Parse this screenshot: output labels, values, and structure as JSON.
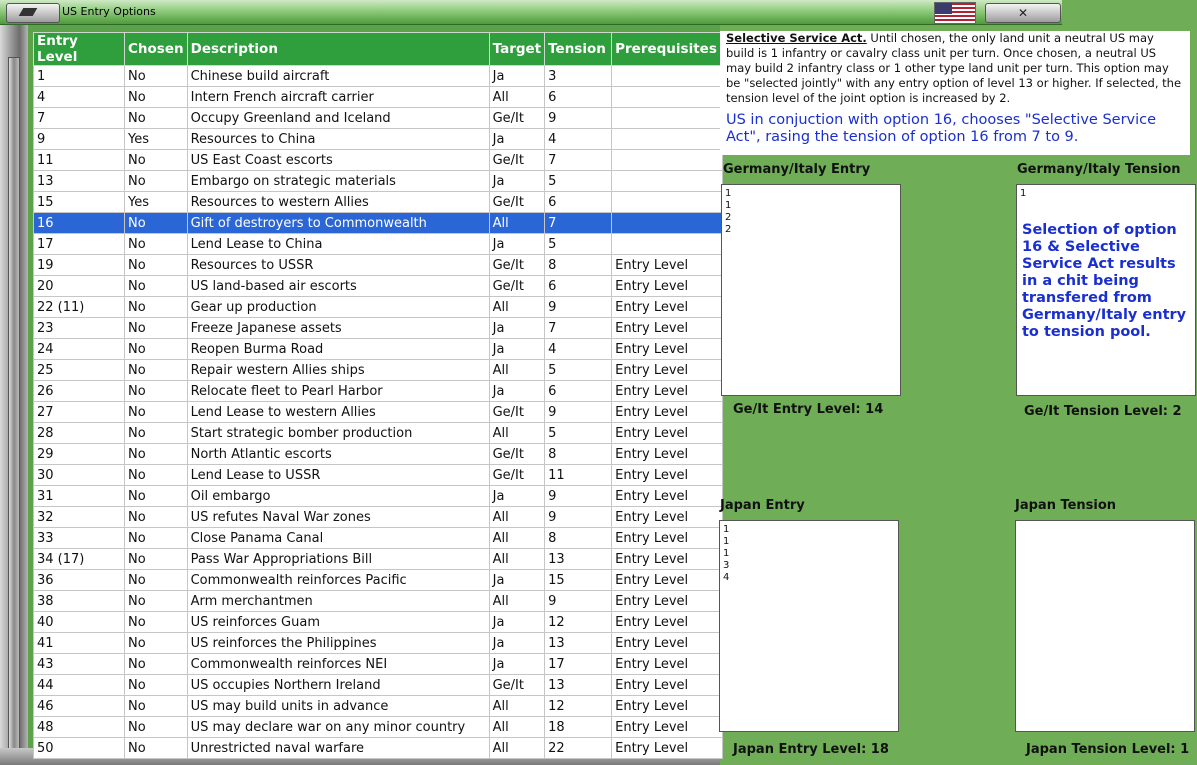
{
  "window": {
    "title": "US Entry Options"
  },
  "table": {
    "headers": [
      "Entry Level",
      "Chosen",
      "Description",
      "Target",
      "Tension",
      "Prerequisites"
    ],
    "rows": [
      [
        "1",
        "No",
        "Chinese build aircraft",
        "Ja",
        "3",
        ""
      ],
      [
        "4",
        "No",
        "Intern French aircraft carrier",
        "All",
        "6",
        ""
      ],
      [
        "7",
        "No",
        "Occupy Greenland and Iceland",
        "Ge/It",
        "9",
        ""
      ],
      [
        "9",
        "Yes",
        "Resources to China",
        "Ja",
        "4",
        ""
      ],
      [
        "11",
        "No",
        "US East Coast escorts",
        "Ge/It",
        "7",
        ""
      ],
      [
        "13",
        "No",
        "Embargo on strategic materials",
        "Ja",
        "5",
        ""
      ],
      [
        "15",
        "Yes",
        "Resources to western Allies",
        "Ge/It",
        "6",
        ""
      ],
      [
        "16",
        "No",
        "Gift of destroyers to Commonwealth",
        "All",
        "7",
        ""
      ],
      [
        "17",
        "No",
        "Lend Lease to China",
        "Ja",
        "5",
        ""
      ],
      [
        "19",
        "No",
        "Resources to USSR",
        "Ge/It",
        "8",
        "Entry Level"
      ],
      [
        "20",
        "No",
        "US land-based air escorts",
        "Ge/It",
        "6",
        "Entry Level"
      ],
      [
        "22 (11)",
        "No",
        "Gear up production",
        "All",
        "9",
        "Entry Level"
      ],
      [
        "23",
        "No",
        "Freeze Japanese assets",
        "Ja",
        "7",
        "Entry Level"
      ],
      [
        "24",
        "No",
        "Reopen Burma Road",
        "Ja",
        "4",
        "Entry Level"
      ],
      [
        "25",
        "No",
        "Repair western Allies ships",
        "All",
        "5",
        "Entry Level"
      ],
      [
        "26",
        "No",
        "Relocate fleet to Pearl Harbor",
        "Ja",
        "6",
        "Entry Level"
      ],
      [
        "27",
        "No",
        "Lend Lease to western Allies",
        "Ge/It",
        "9",
        "Entry Level"
      ],
      [
        "28",
        "No",
        "Start strategic bomber production",
        "All",
        "5",
        "Entry Level"
      ],
      [
        "29",
        "No",
        "North Atlantic escorts",
        "Ge/It",
        "8",
        "Entry Level"
      ],
      [
        "30",
        "No",
        "Lend Lease to USSR",
        "Ge/It",
        "11",
        "Entry Level"
      ],
      [
        "31",
        "No",
        "Oil embargo",
        "Ja",
        "9",
        "Entry Level"
      ],
      [
        "32",
        "No",
        "US refutes Naval War zones",
        "All",
        "9",
        "Entry Level"
      ],
      [
        "33",
        "No",
        "Close Panama Canal",
        "All",
        "8",
        "Entry Level"
      ],
      [
        "34 (17)",
        "No",
        "Pass War Appropriations Bill",
        "All",
        "13",
        "Entry Level"
      ],
      [
        "36",
        "No",
        "Commonwealth reinforces Pacific",
        "Ja",
        "15",
        "Entry Level"
      ],
      [
        "38",
        "No",
        "Arm merchantmen",
        "All",
        "9",
        "Entry Level"
      ],
      [
        "40",
        "No",
        "US reinforces Guam",
        "Ja",
        "12",
        "Entry Level"
      ],
      [
        "41",
        "No",
        "US reinforces the Philippines",
        "Ja",
        "13",
        "Entry Level"
      ],
      [
        "43",
        "No",
        "Commonwealth reinforces NEI",
        "Ja",
        "17",
        "Entry Level"
      ],
      [
        "44",
        "No",
        "US occupies Northern Ireland",
        "Ge/It",
        "13",
        "Entry Level"
      ],
      [
        "46",
        "No",
        "US may build units in advance",
        "All",
        "12",
        "Entry Level"
      ],
      [
        "48",
        "No",
        "US may declare war on any minor country",
        "All",
        "18",
        "Entry Level"
      ],
      [
        "50",
        "No",
        "Unrestricted naval warfare",
        "All",
        "22",
        "Entry Level"
      ]
    ],
    "selected_row": 7
  },
  "description": {
    "heading": "Selective Service Act.",
    "body": " Until chosen, the only land unit a neutral US may build is 1 infantry or cavalry class unit per turn. Once chosen, a neutral US may build 2 infantry class or 1 other type land unit per turn.  This option may be \"selected jointly\" with any entry option of level 13 or higher. If selected, the tension level of the joint option is increased by 2.",
    "note": "US in conjuction with option 16, chooses \"Selective Service Act\", rasing the tension of option 16 from 7 to 9."
  },
  "pools": {
    "geit_entry": {
      "title": "Germany/Italy Entry",
      "chits": [
        "1",
        "1",
        "2",
        "2"
      ],
      "level_label": "Ge/It Entry Level: 14"
    },
    "geit_tension": {
      "title": "Germany/Italy Tension",
      "chits": [
        "1"
      ],
      "level_label": "Ge/It Tension Level: 2"
    },
    "japan_entry": {
      "title": "Japan Entry",
      "chits": [
        "1",
        "1",
        "1",
        "3",
        "4"
      ],
      "level_label": "Japan Entry Level: 18"
    },
    "japan_tension": {
      "title": "Japan Tension",
      "chits": [],
      "level_label": "Japan Tension Level: 1"
    }
  },
  "tension_note": "Selection of option 16 & Selective Service Act results in a chit being transfered from Germany/Italy entry to tension pool."
}
